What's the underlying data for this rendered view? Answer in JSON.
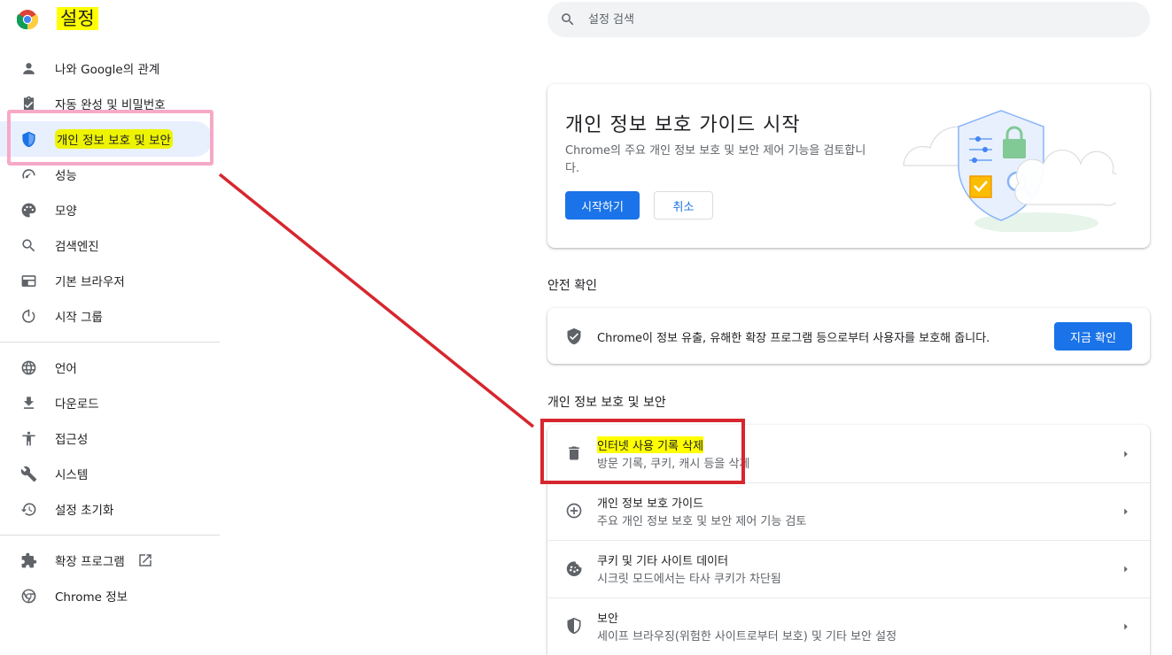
{
  "app": {
    "title": "설정"
  },
  "sidebar": {
    "items": [
      {
        "label": "나와 Google의 관계",
        "icon": "person-icon"
      },
      {
        "label": "자동 완성 및 비밀번호",
        "icon": "clipboard-icon"
      },
      {
        "label": "개인 정보 보호 및 보안",
        "icon": "shield-icon",
        "active": true
      },
      {
        "label": "성능",
        "icon": "speedometer-icon"
      },
      {
        "label": "모양",
        "icon": "palette-icon"
      },
      {
        "label": "검색엔진",
        "icon": "search-icon"
      },
      {
        "label": "기본 브라우저",
        "icon": "browser-icon"
      },
      {
        "label": "시작 그룹",
        "icon": "power-icon"
      }
    ],
    "items2": [
      {
        "label": "언어",
        "icon": "globe-icon"
      },
      {
        "label": "다운로드",
        "icon": "download-icon"
      },
      {
        "label": "접근성",
        "icon": "accessibility-icon"
      },
      {
        "label": "시스템",
        "icon": "wrench-icon"
      },
      {
        "label": "설정 초기화",
        "icon": "history-icon"
      }
    ],
    "items3": [
      {
        "label": "확장 프로그램",
        "icon": "puzzle-icon"
      },
      {
        "label": "Chrome 정보",
        "icon": "chrome-icon"
      }
    ]
  },
  "search": {
    "placeholder": "설정 검색"
  },
  "guide": {
    "title": "개인 정보 보호 가이드 시작",
    "description": "Chrome의 주요 개인 정보 보호 및 보안 제어 기능을 검토합니다.",
    "start_label": "시작하기",
    "cancel_label": "취소"
  },
  "safety": {
    "section_title": "안전 확인",
    "text": "Chrome이 정보 유출, 유해한 확장 프로그램 등으로부터 사용자를 보호해 줍니다.",
    "check_label": "지금 확인"
  },
  "privacy": {
    "section_title": "개인 정보 보호 및 보안",
    "rows": [
      {
        "title": "인터넷 사용 기록 삭제",
        "subtitle": "방문 기록, 쿠키, 캐시 등을 삭제",
        "icon": "trash-icon"
      },
      {
        "title": "개인 정보 보호 가이드",
        "subtitle": "주요 개인 정보 보호 및 보안 제어 기능 검토",
        "icon": "compass-icon"
      },
      {
        "title": "쿠키 및 기타 사이트 데이터",
        "subtitle": "시크릿 모드에서는 타사 쿠키가 차단됨",
        "icon": "cookie-icon"
      },
      {
        "title": "보안",
        "subtitle": "세이프 브라우징(위험한 사이트로부터 보호) 및 기타 보안 설정",
        "icon": "shield-half-icon"
      }
    ]
  },
  "colors": {
    "accent": "#1a73e8",
    "highlight": "#ffff00",
    "annotation_red": "#d7262e",
    "annotation_pink": "#f6a9c6"
  }
}
